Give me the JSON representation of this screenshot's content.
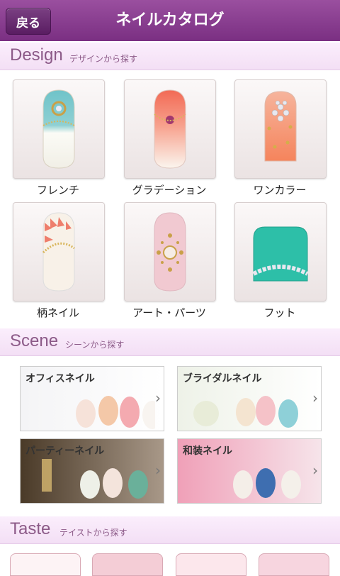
{
  "header": {
    "back_label": "戻る",
    "title": "ネイルカタログ"
  },
  "design": {
    "title_en": "Design",
    "title_jp": "デザインから探す",
    "items": [
      {
        "label": "フレンチ"
      },
      {
        "label": "グラデーション"
      },
      {
        "label": "ワンカラー"
      },
      {
        "label": "柄ネイル"
      },
      {
        "label": "アート・パーツ"
      },
      {
        "label": "フット"
      }
    ]
  },
  "scene": {
    "title_en": "Scene",
    "title_jp": "シーンから探す",
    "items": [
      {
        "label": "オフィスネイル"
      },
      {
        "label": "ブライダルネイル"
      },
      {
        "label": "パーティーネイル"
      },
      {
        "label": "和装ネイル"
      }
    ]
  },
  "taste": {
    "title_en": "Taste",
    "title_jp": "テイストから探す"
  },
  "colors": {
    "header": "#8a3f90",
    "section_text": "#8c5a88"
  }
}
